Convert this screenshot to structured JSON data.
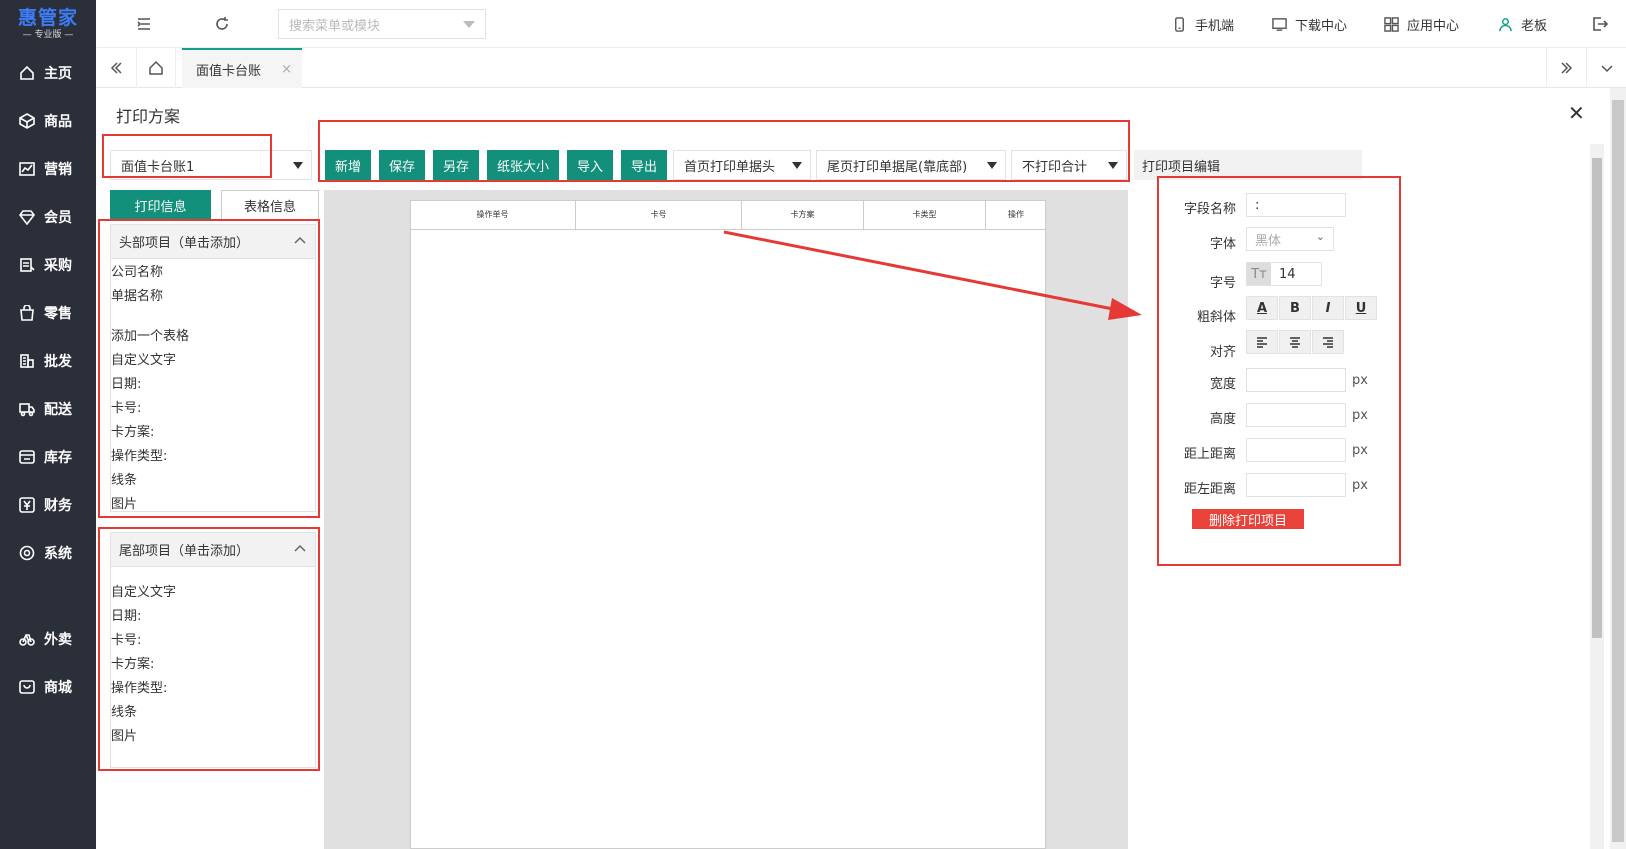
{
  "logo": {
    "name": "惠管家",
    "sub": "专业版"
  },
  "nav": [
    {
      "label": "主页",
      "icon": "home-icon"
    },
    {
      "label": "商品",
      "icon": "box-icon"
    },
    {
      "label": "营销",
      "icon": "chart-icon"
    },
    {
      "label": "会员",
      "icon": "diamond-icon"
    },
    {
      "label": "采购",
      "icon": "purchase-icon"
    },
    {
      "label": "零售",
      "icon": "bag-icon"
    },
    {
      "label": "批发",
      "icon": "building-icon"
    },
    {
      "label": "配送",
      "icon": "truck-icon"
    },
    {
      "label": "库存",
      "icon": "warehouse-icon"
    },
    {
      "label": "财务",
      "icon": "yen-icon"
    },
    {
      "label": "系统",
      "icon": "gear-icon"
    },
    {
      "label": "外卖",
      "icon": "bike-icon"
    },
    {
      "label": "商城",
      "icon": "store-icon"
    }
  ],
  "topbar": {
    "search_placeholder": "搜索菜单或模块",
    "links": [
      "手机端",
      "下载中心",
      "应用中心",
      "老板"
    ]
  },
  "tabs": {
    "active": "面值卡台账"
  },
  "panel": {
    "title": "打印方案",
    "scheme": "面值卡台账1",
    "buttons": [
      "新增",
      "保存",
      "另存",
      "纸张大小",
      "导入",
      "导出"
    ],
    "dropdowns": [
      "首页打印单据头",
      "尾页打印单据尾(靠底部)",
      "不打印合计"
    ],
    "editor_title": "打印项目编辑",
    "tab_print": "打印信息",
    "tab_table": "表格信息"
  },
  "header_group": {
    "title": "头部项目（单击添加）",
    "items": [
      "公司名称",
      "单据名称",
      "添加一个表格",
      "自定义文字",
      "日期:",
      "卡号:",
      "卡方案:",
      "操作类型:",
      "线条",
      "图片"
    ]
  },
  "footer_group": {
    "title": "尾部项目（单击添加）",
    "items": [
      "自定义文字",
      "日期:",
      "卡号:",
      "卡方案:",
      "操作类型:",
      "线条",
      "图片"
    ]
  },
  "table_headers": [
    "操作单号",
    "卡号",
    "卡方案",
    "卡类型",
    "操作"
  ],
  "editor": {
    "field_name_label": "字段名称",
    "field_name_value": ":",
    "font_label": "字体",
    "font_value": "黑体",
    "size_label": "字号",
    "size_value": "14",
    "style_label": "粗斜体",
    "align_label": "对齐",
    "width_label": "宽度",
    "height_label": "高度",
    "top_label": "距上距离",
    "left_label": "距左距离",
    "unit": "px",
    "delete_label": "删除打印项目"
  },
  "colors": {
    "accent": "#13907b",
    "sidebar": "#2b2f3a",
    "danger": "#e9423a",
    "annotation": "#e53935"
  }
}
